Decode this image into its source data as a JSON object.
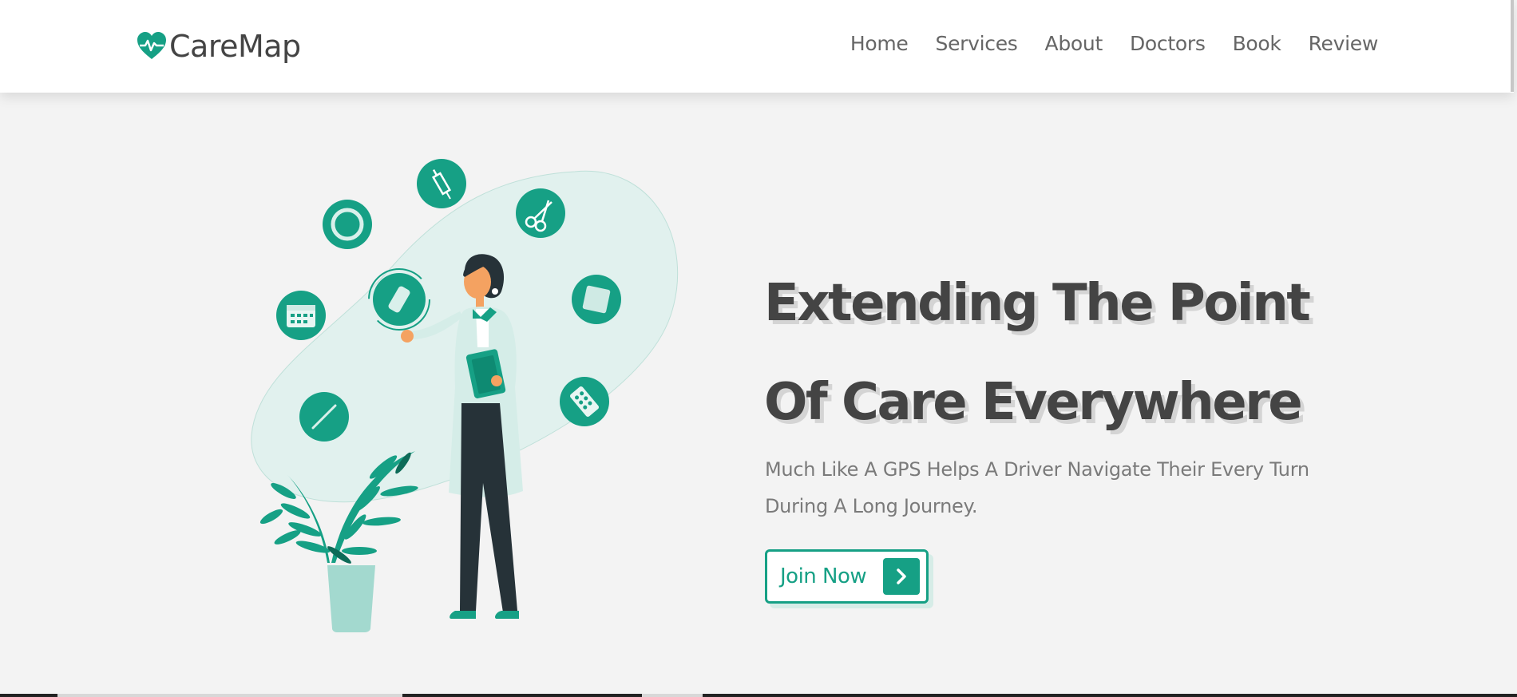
{
  "brand": {
    "name": "CareMap",
    "accent_color": "#16a085",
    "logo_icon": "heart-pulse-icon"
  },
  "nav": {
    "items": [
      {
        "label": "Home"
      },
      {
        "label": "Services"
      },
      {
        "label": "About"
      },
      {
        "label": "Doctors"
      },
      {
        "label": "Book"
      },
      {
        "label": "Review"
      }
    ]
  },
  "hero": {
    "title_line1": "Extending The Point",
    "title_line2": "Of Care Everywhere",
    "subtitle": "Much Like A GPS Helps A Driver Navigate Their Every Turn During A Long Journey.",
    "cta_label": "Join Now",
    "cta_icon": "chevron-right-icon",
    "illustration_icons": [
      "syringe-icon",
      "scissors-icon",
      "ring-icon",
      "bandage-icon",
      "sticky-note-icon",
      "calendar-icon",
      "thermometer-icon",
      "pill-pack-icon"
    ]
  }
}
